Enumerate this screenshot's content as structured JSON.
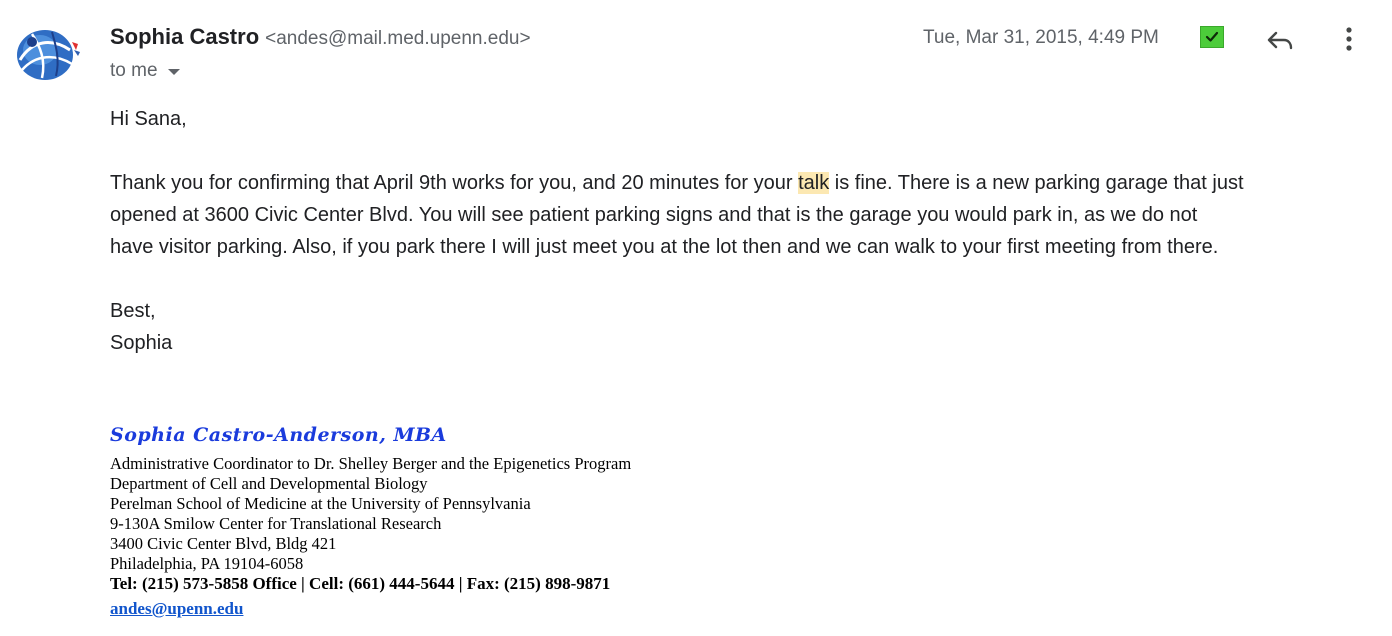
{
  "sender": {
    "name": "Sophia Castro",
    "email": "<andes@mail.med.upenn.edu>"
  },
  "recipient_label": "to me",
  "date": "Tue, Mar 31, 2015, 4:49 PM",
  "icons": {
    "avatar": "sender-logo-avatar",
    "check": "green-checkmark-icon",
    "reply": "reply-arrow-icon",
    "more": "more-vertical-icon",
    "dropdown": "caret-down-icon"
  },
  "colors": {
    "check_green": "#4ccc3a",
    "signature_name_blue": "#1a3bdc",
    "link_blue": "#1155cc",
    "highlight": "#fce8b2"
  },
  "body": {
    "greeting": "Hi Sana,",
    "paragraph": {
      "line1_before": "Thank you for confirming that April 9th works for you, and 20 minutes for your ",
      "line1_highlight": "talk",
      "line1_after": " is fine.  There is a new parking garage that just",
      "line2": "opened at 3600 Civic Center Blvd.  You will see patient parking signs and that is the garage you would park in, as we do not",
      "line3": "have visitor parking.  Also, if you park there I will just meet you at the lot then and we can walk to your first meeting from there."
    },
    "closing": "Best,",
    "signoff": "Sophia"
  },
  "signature": {
    "name": "Sophia Castro-Anderson, MBA",
    "lines": [
      "Administrative Coordinator to Dr. Shelley Berger and the Epigenetics Program",
      "Department of Cell and Developmental Biology",
      "Perelman School of Medicine at the University of Pennsylvania",
      "9-130A Smilow Center for Translational Research",
      "3400 Civic Center Blvd, Bldg 421",
      "Philadelphia, PA  19104-6058"
    ],
    "phones": "Tel: (215) 573-5858 Office | Cell: (661) 444-5644 | Fax: (215) 898-9871",
    "email_link": "andes@upenn.edu"
  }
}
